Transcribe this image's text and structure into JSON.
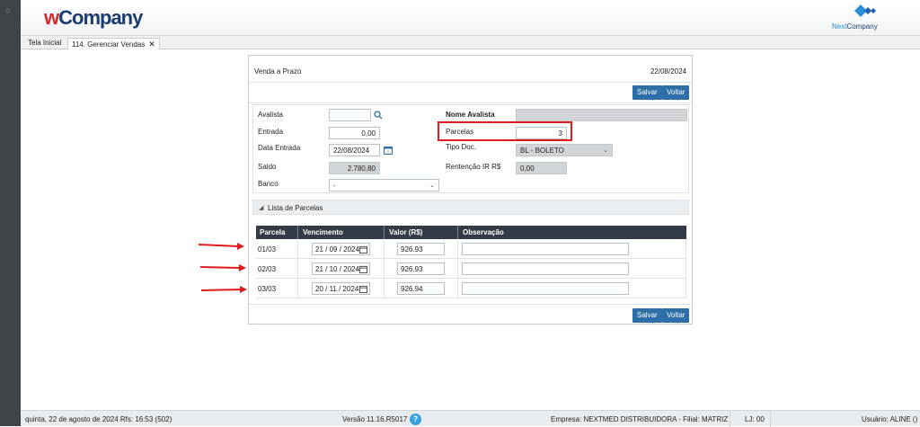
{
  "app": {
    "logo_w": "w",
    "logo_rest": "Company",
    "partner_logo_next": "Next",
    "partner_logo_company": "Company",
    "accent_color": "#2d6fa8",
    "highlight_color": "#e01b1b"
  },
  "tabs": [
    {
      "label": "Tela Inicial"
    },
    {
      "label": "114. Gerenciar Vendas",
      "close": "✕"
    }
  ],
  "panel": {
    "title": "Venda a Prazo",
    "date": "22/08/2024",
    "save_label": "Salvar",
    "back_label": "Voltar"
  },
  "form": {
    "avalista_label": "Avalista",
    "avalista_value": "",
    "nome_avalista_label": "Nome Avalista",
    "nome_avalista_value": "",
    "entrada_label": "Entrada",
    "entrada_value": "0,00",
    "parcelas_label": "Parcelas",
    "parcelas_value": "3",
    "data_entrada_label": "Data Entrada",
    "data_entrada_value": "22/08/2024",
    "tipo_doc_label": "Tipo Doc.",
    "tipo_doc_value": "BL - BOLETO",
    "saldo_label": "Saldo",
    "saldo_value": "2.780,80",
    "retencao_label": "Rentenção IR R$",
    "retencao_value": "0,00",
    "banco_label": "Banco",
    "banco_value": "-"
  },
  "list": {
    "title": "Lista de Parcelas",
    "columns": [
      "Parcela",
      "Vencimento",
      "Valor (R$)",
      "Observação"
    ],
    "rows": [
      {
        "parcela": "01/03",
        "vencimento": "21 / 09 / 2024",
        "valor": "926.93",
        "observacao": ""
      },
      {
        "parcela": "02/03",
        "vencimento": "21 / 10 / 2024",
        "valor": "926.93",
        "observacao": ""
      },
      {
        "parcela": "03/03",
        "vencimento": "20 / 11 / 2024",
        "valor": "926.94",
        "observacao": ""
      }
    ]
  },
  "status": {
    "datetime": "quinta, 22 de agosto de 2024  Rfs: 16:53 (502)",
    "version": "Versão 11.16.R5017",
    "help": "?",
    "empresa": "Empresa: NEXTMED DISTRIBUIDORA - Filial: MATRIZ",
    "lj": "LJ: 00",
    "usuario": "Usuário: ALINE ()"
  }
}
